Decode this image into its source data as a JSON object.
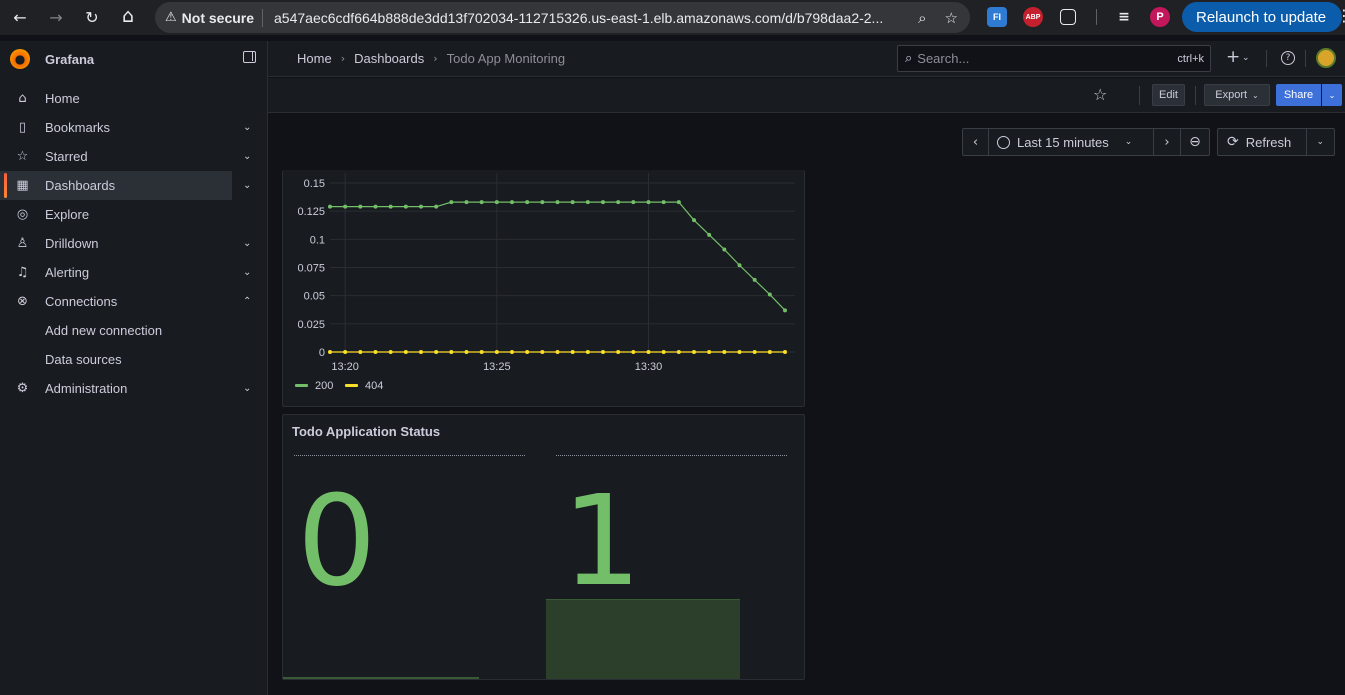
{
  "browser": {
    "back": "←",
    "forward": "→",
    "reload": "↻",
    "home": "⌂",
    "security_label": "Not secure",
    "url": "a547aec6cdf664b888de3dd13f702034-112715326.us-east-1.elb.amazonaws.com/d/b798daa2-2...",
    "relaunch_label": "Relaunch to update",
    "ext_abp": "ABP",
    "ext_fi": "FI",
    "profile_initial": "P"
  },
  "sidebar": {
    "brand": "Grafana",
    "items": [
      {
        "label": "Home",
        "icon": "home-icon",
        "glyph": "⌂"
      },
      {
        "label": "Bookmarks",
        "icon": "bookmark-icon",
        "glyph": "▯"
      },
      {
        "label": "Starred",
        "icon": "star-icon",
        "glyph": "☆"
      },
      {
        "label": "Dashboards",
        "icon": "dashboards-icon",
        "glyph": "▦"
      },
      {
        "label": "Explore",
        "icon": "compass-icon",
        "glyph": "◎"
      },
      {
        "label": "Drilldown",
        "icon": "drilldown-icon",
        "glyph": "♙"
      },
      {
        "label": "Alerting",
        "icon": "bell-icon",
        "glyph": "♫"
      },
      {
        "label": "Connections",
        "icon": "connections-icon",
        "glyph": "⊗"
      },
      {
        "label": "Add new connection"
      },
      {
        "label": "Data sources"
      },
      {
        "label": "Administration",
        "icon": "gear-icon",
        "glyph": "⚙"
      }
    ]
  },
  "topbar": {
    "crumbs": [
      "Home",
      "Dashboards",
      "Todo App Monitoring"
    ],
    "search_placeholder": "Search...",
    "search_shortcut": "ctrl+k",
    "plus": "+",
    "help": "?"
  },
  "actions": {
    "edit": "Edit",
    "export": "Export",
    "share": "Share"
  },
  "timepicker": {
    "range": "Last 15 minutes",
    "refresh": "Refresh"
  },
  "chart_data": {
    "type": "line",
    "title": "",
    "xlabel": "",
    "ylabel": "",
    "ylim": [
      0,
      0.15
    ],
    "yticks": [
      "0",
      "0.025",
      "0.05",
      "0.075",
      "0.1",
      "0.125",
      "0.15"
    ],
    "xticks": [
      "13:20",
      "13:25",
      "13:30"
    ],
    "grid": true,
    "legend_placement": "bottom-left",
    "x": [
      "13:19:30",
      "13:20:00",
      "13:20:30",
      "13:21:00",
      "13:21:30",
      "13:22:00",
      "13:22:30",
      "13:23:00",
      "13:23:30",
      "13:24:00",
      "13:24:30",
      "13:25:00",
      "13:25:30",
      "13:26:00",
      "13:26:30",
      "13:27:00",
      "13:27:30",
      "13:28:00",
      "13:28:30",
      "13:29:00",
      "13:29:30",
      "13:30:00",
      "13:30:30",
      "13:31:00",
      "13:31:30",
      "13:32:00",
      "13:32:30",
      "13:33:00",
      "13:33:30",
      "13:34:00"
    ],
    "series": [
      {
        "name": "200",
        "color": "#73bf69",
        "values": [
          0.129,
          0.129,
          0.129,
          0.129,
          0.129,
          0.129,
          0.129,
          0.129,
          0.133,
          0.133,
          0.133,
          0.133,
          0.133,
          0.133,
          0.133,
          0.133,
          0.133,
          0.133,
          0.133,
          0.133,
          0.133,
          0.133,
          0.133,
          0.133,
          0.117,
          0.104,
          0.091,
          0.077,
          0.064,
          0.051,
          0.037
        ]
      },
      {
        "name": "404",
        "color": "#fade2a",
        "values": [
          0,
          0,
          0,
          0,
          0,
          0,
          0,
          0,
          0,
          0,
          0,
          0,
          0,
          0,
          0,
          0,
          0,
          0,
          0,
          0,
          0,
          0,
          0,
          0,
          0,
          0,
          0,
          0,
          0,
          0,
          0
        ]
      }
    ]
  },
  "status_panel": {
    "title": "Todo Application Status",
    "values": [
      "0",
      "1"
    ],
    "color": "#73bf69",
    "fill_fractions": [
      0.0,
      1.0
    ]
  }
}
